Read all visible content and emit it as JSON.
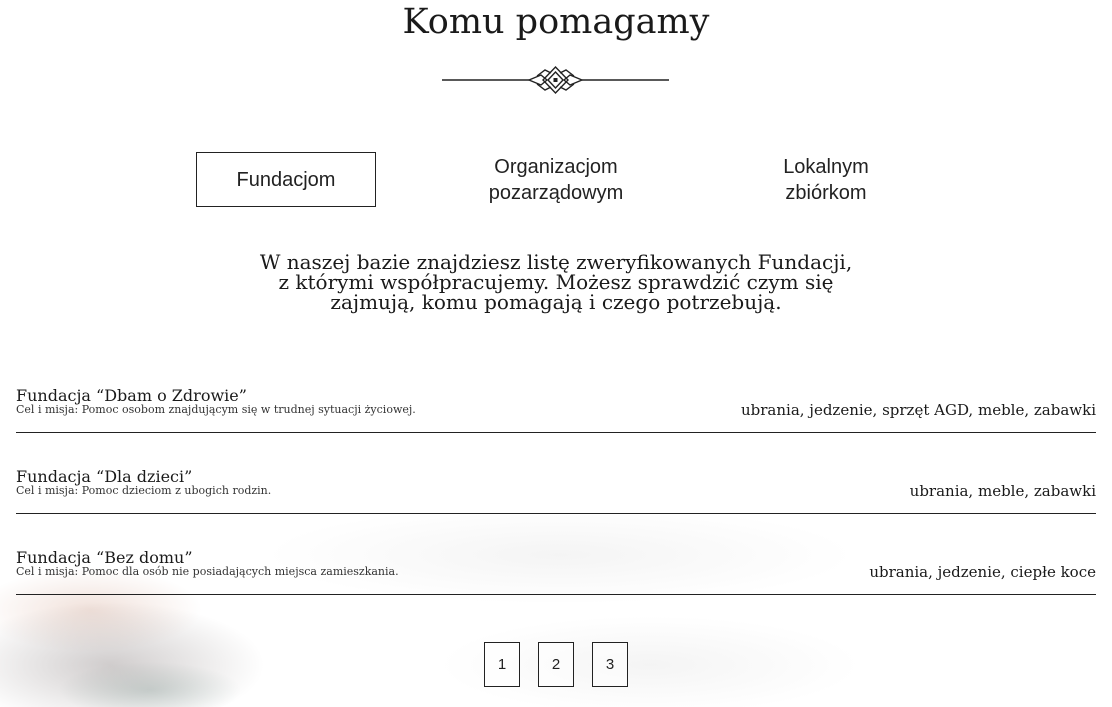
{
  "header": {
    "title": "Komu pomagamy",
    "ornament_icon": "decorative-divider-icon"
  },
  "tabs": [
    {
      "label_line1": "Fundacjom",
      "label_line2": "",
      "active": true
    },
    {
      "label_line1": "Organizacjom",
      "label_line2": "pozarządowym",
      "active": false
    },
    {
      "label_line1": "Lokalnym",
      "label_line2": "zbiórkom",
      "active": false
    }
  ],
  "intro": {
    "line1": "W naszej bazie znajdziesz listę zweryfikowanych Fundacji,",
    "line2": "z którymi współpracujemy. Możesz sprawdzić czym się",
    "line3": "zajmują, komu pomagają i czego potrzebują."
  },
  "organizations": [
    {
      "name": "Fundacja “Dbam o Zdrowie”",
      "mission": "Cel i misja: Pomoc osobom znajdującym się w trudnej sytuacji życiowej.",
      "needs": "ubrania, jedzenie, sprzęt AGD, meble, zabawki"
    },
    {
      "name": "Fundacja “Dla dzieci”",
      "mission": "Cel i misja: Pomoc dzieciom z ubogich rodzin.",
      "needs": "ubrania, meble, zabawki"
    },
    {
      "name": "Fundacja “Bez domu”",
      "mission": "Cel i misja: Pomoc dla osób nie posiadających miejsca zamieszkania.",
      "needs": "ubrania, jedzenie, ciepłe koce"
    }
  ],
  "pagination": {
    "pages": [
      "1",
      "2",
      "3"
    ]
  }
}
